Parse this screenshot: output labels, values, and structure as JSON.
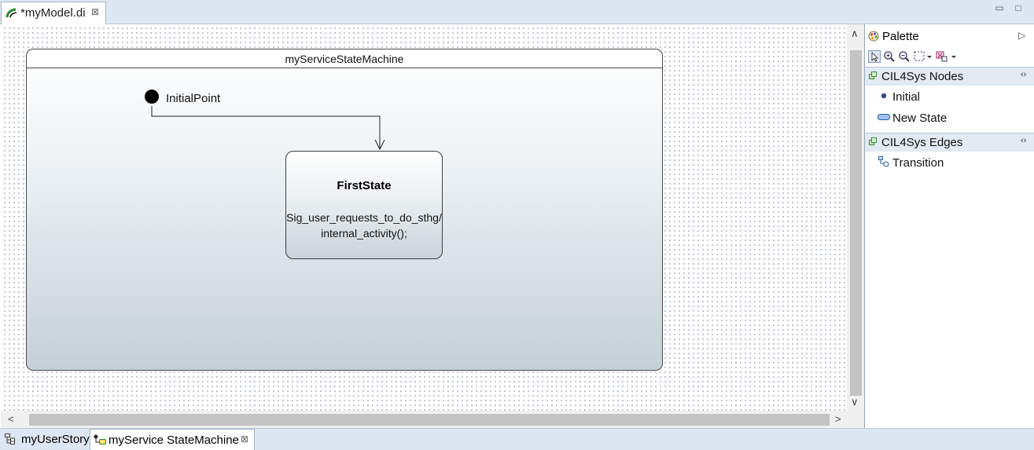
{
  "editor": {
    "tab_label": "*myModel.di",
    "close_glyph": "⊠",
    "minimize_glyph": "▭",
    "maximize_glyph": "□"
  },
  "diagram": {
    "state_machine_name": "myServiceStateMachine",
    "initial_label": "InitialPoint",
    "state_name": "FirstState",
    "state_activity_line1": "Sig_user_requests_to_do_sthg/",
    "state_activity_line2": "internal_activity();"
  },
  "scroll": {
    "up": "∧",
    "down": "∨",
    "left": "<",
    "right": ">"
  },
  "palette": {
    "title": "Palette",
    "expand_glyph": "▷",
    "tools": [
      "select-icon",
      "zoom-in-icon",
      "zoom-out-icon",
      "marquee-icon",
      "dropdown-icon",
      "connection-icon",
      "dropdown-icon"
    ],
    "drawers": [
      {
        "label": "CIL4Sys Nodes",
        "toggle": "‹›",
        "entries": [
          {
            "label": "Initial",
            "icon": "initial-node-icon"
          },
          {
            "label": "New State",
            "icon": "state-node-icon"
          }
        ]
      },
      {
        "label": "CIL4Sys Edges",
        "toggle": "‹›",
        "entries": [
          {
            "label": "Transition",
            "icon": "transition-icon"
          }
        ]
      }
    ]
  },
  "bottom_tabs": [
    {
      "label": "myUserStory",
      "icon": "tree-icon"
    },
    {
      "label": "myService StateMachine",
      "icon": "state-machine-icon",
      "active": true
    }
  ],
  "colors": {
    "tab_bar": "#dde7f3",
    "drawer_head": "#e2eaf3",
    "frame_border": "#4a4a4a"
  }
}
